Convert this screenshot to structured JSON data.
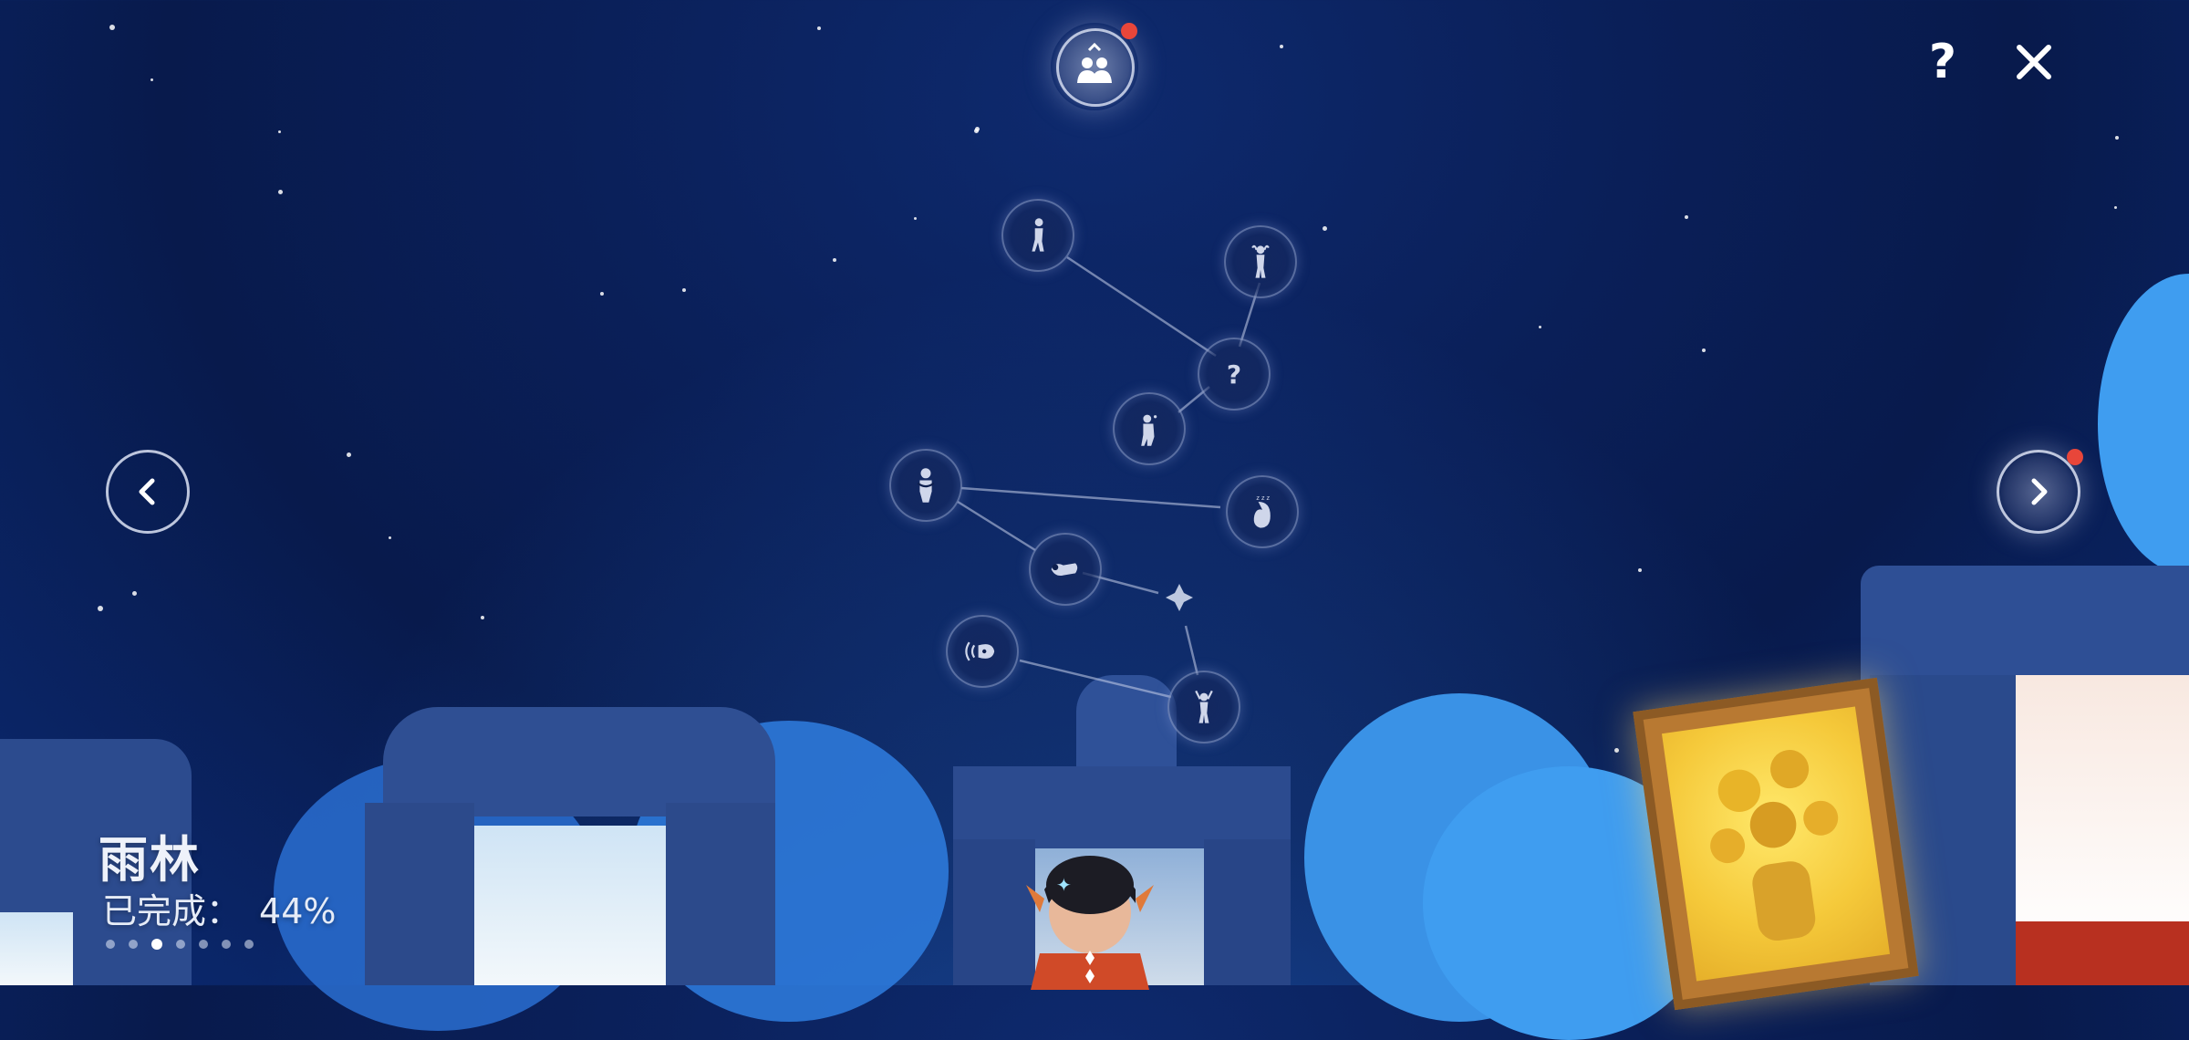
{
  "area": {
    "title": "雨林",
    "completed_label": "已完成：",
    "completed_value": "44%",
    "page_count": 7,
    "active_page": 2
  },
  "top_bar": {
    "help_glyph": "?",
    "close_glyph": "✕",
    "friends_icon": "friends-icon",
    "friends_notification": true
  },
  "navigation": {
    "prev_icon": "chevron-left-icon",
    "next_icon": "chevron-right-icon",
    "next_notification": true
  },
  "constellation": {
    "unknown_glyph": "?",
    "nodes": [
      {
        "id": "spirit-1",
        "icon": "spirit-standing-icon"
      },
      {
        "id": "spirit-2",
        "icon": "spirit-hands-on-head-icon"
      },
      {
        "id": "spirit-3",
        "icon": "unknown-spirit-icon"
      },
      {
        "id": "spirit-4",
        "icon": "spirit-crouching-icon"
      },
      {
        "id": "spirit-5",
        "icon": "spirit-praying-icon"
      },
      {
        "id": "spirit-6",
        "icon": "spirit-sleeping-icon"
      },
      {
        "id": "spirit-7",
        "icon": "spirit-lying-icon"
      },
      {
        "id": "spirit-8",
        "icon": "spirit-calling-icon"
      },
      {
        "id": "spirit-9",
        "icon": "spirit-cheering-icon"
      }
    ]
  },
  "colors": {
    "sky": "#0a1f58",
    "notification": "#e8463a",
    "node_ring": "#a0afd7"
  }
}
